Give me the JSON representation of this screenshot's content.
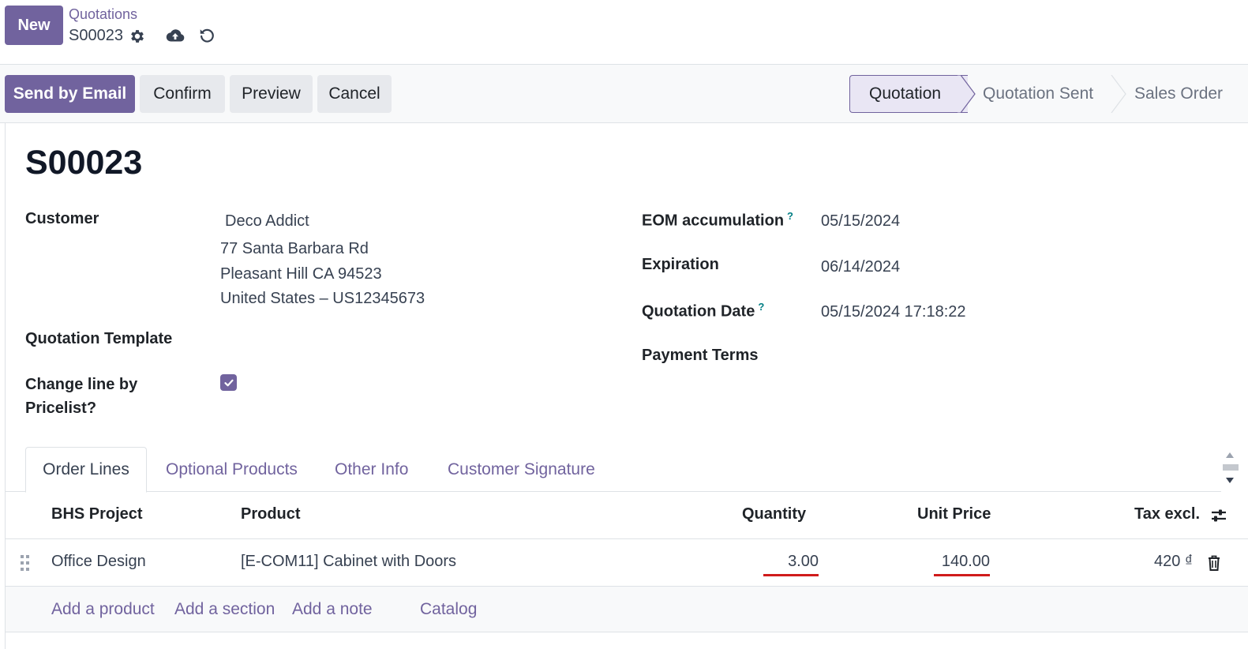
{
  "control_panel": {
    "new_label": "New",
    "breadcrumb": "Quotations",
    "record_name": "S00023"
  },
  "actions": {
    "send_email": "Send by Email",
    "confirm": "Confirm",
    "preview": "Preview",
    "cancel": "Cancel"
  },
  "statusbar": {
    "stages": [
      "Quotation",
      "Quotation Sent",
      "Sales Order"
    ],
    "active": "Quotation"
  },
  "form": {
    "title": "S00023",
    "customer_label": "Customer",
    "customer_name": "Deco Addict",
    "address_line1": "77 Santa Barbara Rd",
    "address_line2": "Pleasant Hill CA 94523",
    "address_line3": "United States – US12345673",
    "quotation_template_label": "Quotation Template",
    "change_line_label_1": "Change line by",
    "change_line_label_2": "Pricelist?",
    "change_line_checked": true,
    "eom_label": "EOM accumulation",
    "eom_value": "05/15/2024",
    "expiration_label": "Expiration",
    "expiration_value": "06/14/2024",
    "quotation_date_label": "Quotation Date",
    "quotation_date_value": "05/15/2024 17:18:22",
    "payment_terms_label": "Payment Terms",
    "help_mark": "?"
  },
  "tabs": [
    "Order Lines",
    "Optional Products",
    "Other Info",
    "Customer Signature"
  ],
  "order_lines": {
    "headers": {
      "project": "BHS Project",
      "product": "Product",
      "quantity": "Quantity",
      "unit_price": "Unit Price",
      "tax_excl": "Tax excl."
    },
    "rows": [
      {
        "project": "Office Design",
        "product": "[E-COM11] Cabinet with Doors",
        "quantity": "3.00",
        "unit_price": "140.00",
        "subtotal": "420 ₫"
      }
    ],
    "add_links": {
      "product": "Add a product",
      "section": "Add a section",
      "note": "Add a note",
      "catalog": "Catalog"
    }
  },
  "colors": {
    "primary": "#71639e",
    "highlight": "#d01b1b"
  }
}
